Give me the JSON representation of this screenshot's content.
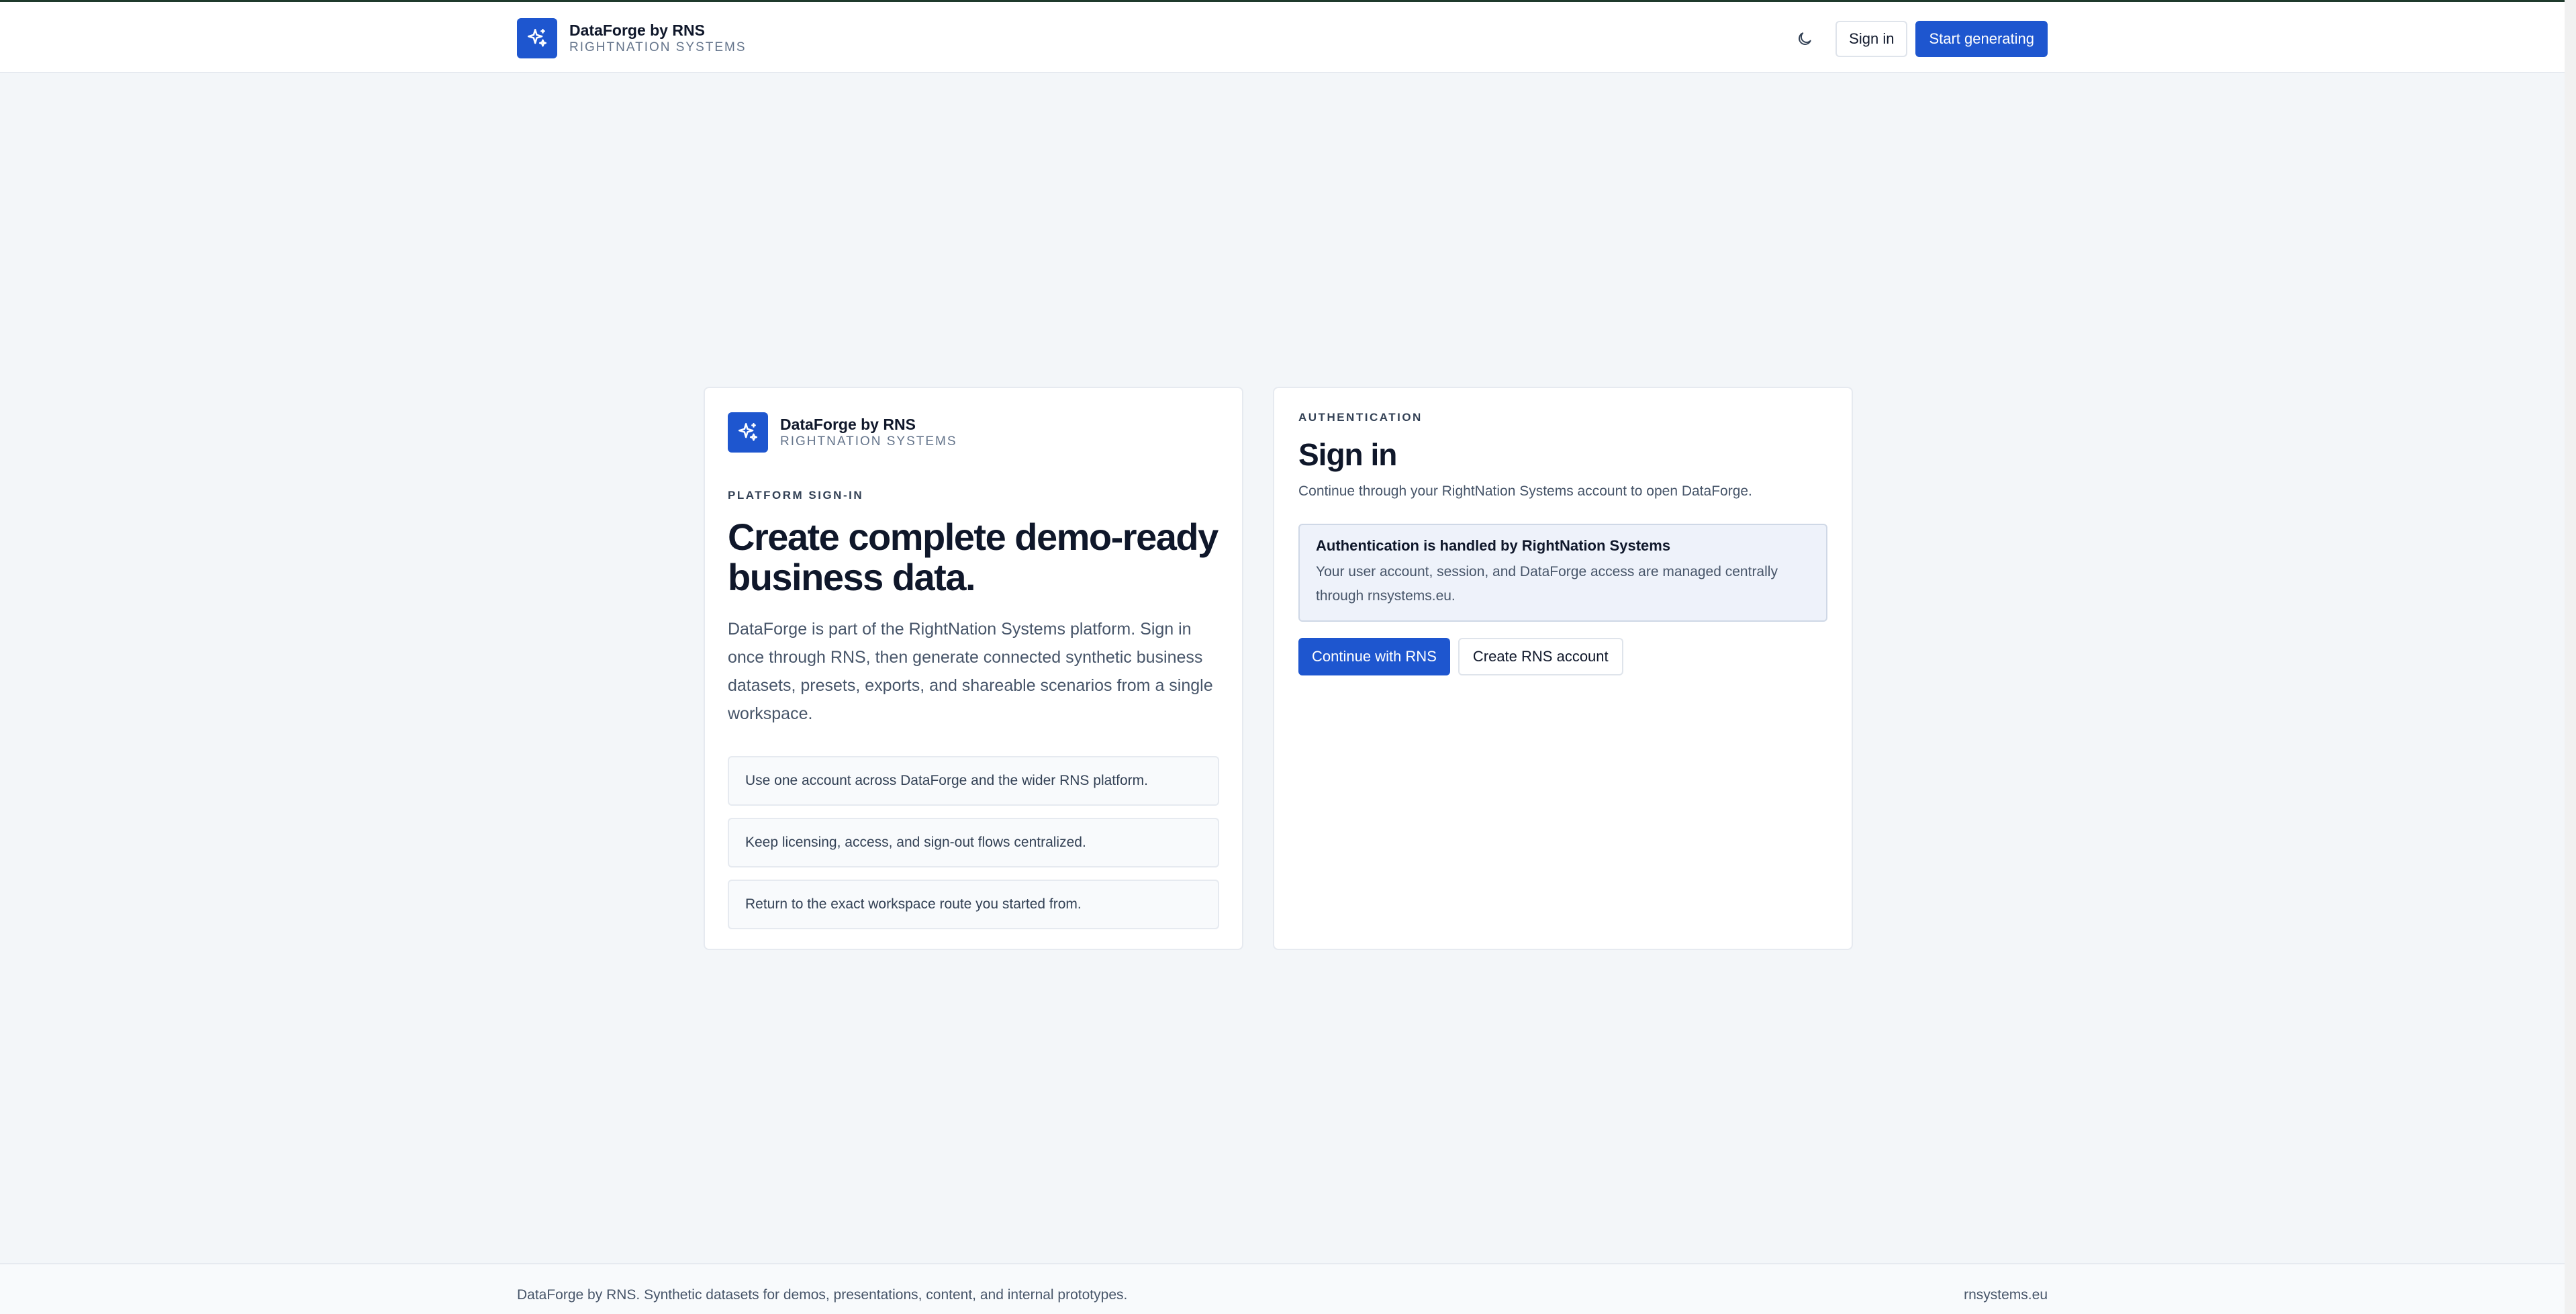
{
  "header": {
    "brand_name": "DataForge by RNS",
    "brand_sub": "RIGHTNATION SYSTEMS",
    "theme_toggle_icon": "moon-icon",
    "signin_label": "Sign in",
    "start_label": "Start generating"
  },
  "left_card": {
    "brand_name": "DataForge by RNS",
    "brand_sub": "RIGHTNATION SYSTEMS",
    "eyebrow": "PLATFORM SIGN-IN",
    "title": "Create complete demo-ready business data.",
    "description": "DataForge is part of the RightNation Systems platform. Sign in once through RNS, then generate connected synthetic business datasets, presets, exports, and shareable scenarios from a single workspace.",
    "features": [
      "Use one account across DataForge and the wider RNS platform.",
      "Keep licensing, access, and sign-out flows centralized.",
      "Return to the exact workspace route you started from."
    ]
  },
  "right_card": {
    "eyebrow": "AUTHENTICATION",
    "title": "Sign in",
    "description": "Continue through your RightNation Systems account to open DataForge.",
    "notice_title": "Authentication is handled by RightNation Systems",
    "notice_body": "Your user account, session, and DataForge access are managed centrally through rnsystems.eu.",
    "continue_label": "Continue with RNS",
    "create_label": "Create RNS account"
  },
  "footer": {
    "left_text": "DataForge by RNS. Synthetic datasets for demos, presentations, content, and internal prototypes.",
    "right_text": "rnsystems.eu"
  },
  "colors": {
    "accent": "#1e56cf",
    "background": "#f3f6f9",
    "card": "#ffffff",
    "notice_bg": "#eef2fa"
  }
}
